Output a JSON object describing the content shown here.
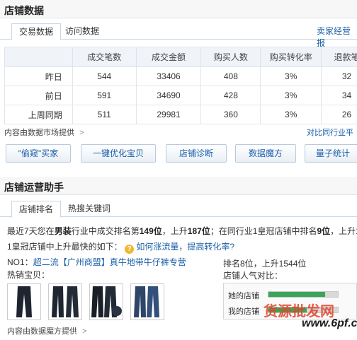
{
  "store_data": {
    "title": "店铺数据",
    "tabs": [
      "交易数据",
      "访问数据"
    ],
    "top_right_link": "卖家经营报",
    "table": {
      "headers": [
        "",
        "成交笔数",
        "成交金额",
        "购买人数",
        "购买转化率",
        "退款笔"
      ],
      "rows": [
        {
          "label": "昨日",
          "cells": [
            "544",
            "33406",
            "408",
            "3%",
            "32"
          ]
        },
        {
          "label": "前日",
          "cells": [
            "591",
            "34690",
            "428",
            "3%",
            "34"
          ]
        },
        {
          "label": "上周同期",
          "cells": [
            "511",
            "29981",
            "360",
            "3%",
            "26"
          ]
        }
      ]
    },
    "source_note": "内容由数据市场提供",
    "source_arrow": ">",
    "compare_link": "对比同行业平",
    "buttons": [
      "\"偷窥\"买家",
      "一键优化宝贝",
      "店铺诊断",
      "数据魔方",
      "量子统计"
    ]
  },
  "assistant": {
    "title": "店铺运营助手",
    "tabs": [
      "店铺排名",
      "热搜关键词"
    ],
    "line1_a": "最近7天您在",
    "line1_industry": "男装",
    "line1_b": "行业中成交排名第",
    "line1_rank": "149位",
    "line1_c": "，上升",
    "line1_up": "187位",
    "line1_d": "；在同行业1皇冠店铺中排名",
    "line1_rank2": "9位",
    "line1_e": "，上升13",
    "line2_a": "1皇冠店铺中上升最快的如下：",
    "help_icon": "?",
    "help_link": "如何涨流量，提高转化率?",
    "no1_label": "NO1：",
    "no1_shop": "超二流【广州商盟】真牛地带牛仔裤专营",
    "hot_items_label": "热销宝贝：",
    "rank_text": "排名8位，上升1544位",
    "popularity_label": "店铺人气对比：",
    "compare_bars": [
      {
        "label": "她的店铺",
        "value": 0.82
      },
      {
        "label": "我的店铺",
        "value": 0.55
      }
    ],
    "source_note": "内容由数据魔方提供",
    "source_arrow": ">",
    "watermark_cn": "货源批发网",
    "watermark_en": "www.6pf.cn"
  }
}
